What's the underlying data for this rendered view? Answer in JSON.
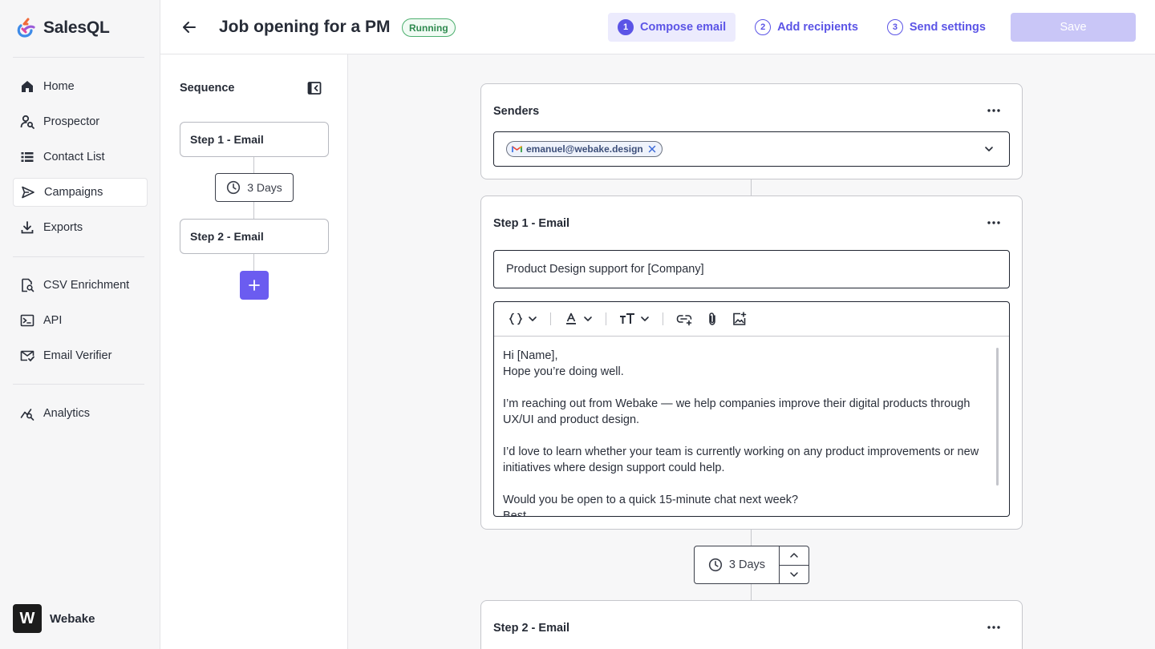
{
  "app": {
    "name": "SalesQL"
  },
  "sidebar": {
    "items": [
      {
        "label": "Home",
        "icon": "home-icon"
      },
      {
        "label": "Prospector",
        "icon": "prospector-icon"
      },
      {
        "label": "Contact List",
        "icon": "list-icon"
      },
      {
        "label": "Campaigns",
        "icon": "send-icon",
        "active": true
      },
      {
        "label": "Exports",
        "icon": "download-icon"
      },
      {
        "label": "CSV Enrichment",
        "icon": "csv-search-icon"
      },
      {
        "label": "API",
        "icon": "terminal-icon"
      },
      {
        "label": "Email Verifier",
        "icon": "mail-check-icon"
      },
      {
        "label": "Analytics",
        "icon": "analytics-icon"
      }
    ],
    "workspace": {
      "initial": "W",
      "name": "Webake"
    }
  },
  "header": {
    "title": "Job opening for a PM",
    "status": "Running",
    "steps": [
      {
        "num": "1",
        "label": "Compose email",
        "active": true
      },
      {
        "num": "2",
        "label": "Add recipients"
      },
      {
        "num": "3",
        "label": "Send settings"
      }
    ],
    "save_label": "Save"
  },
  "sequence": {
    "title": "Sequence",
    "steps": [
      "Step 1 - Email",
      "Step 2 - Email"
    ],
    "delay": "3 Days"
  },
  "senders": {
    "title": "Senders",
    "chip": "emanuel@webake.design"
  },
  "step1": {
    "title": "Step 1 - Email",
    "subject": "Product Design support for [Company]",
    "body": [
      "Hi [Name],",
      "Hope you’re doing well.",
      "",
      "I’m reaching out from Webake — we help companies improve their digital products through UX/UI and product design.",
      "",
      "I’d love to learn whether your team is currently working on any product improvements or new initiatives where design support could help.",
      "",
      "Would you be open to a quick 15-minute chat next week?",
      "Best,"
    ]
  },
  "delay": {
    "label": "3 Days"
  },
  "step2": {
    "title": "Step 2 - Email"
  },
  "colors": {
    "accent": "#5b54e6",
    "status": "#2f8a4f",
    "disabled": "#c9c6f7"
  }
}
